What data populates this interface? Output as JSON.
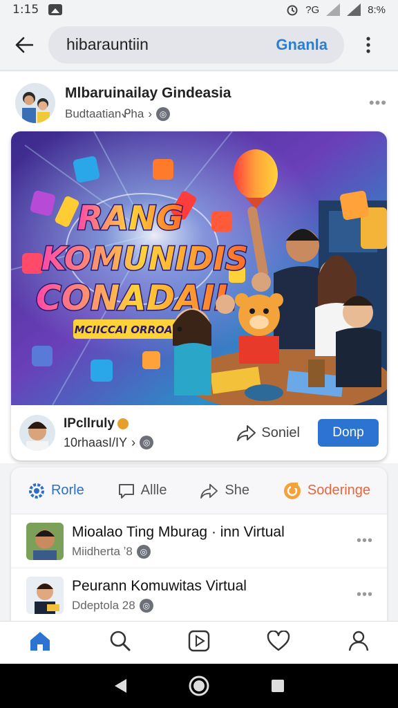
{
  "status_bar": {
    "time": "1:15",
    "battery": "8:%",
    "network": "?G"
  },
  "app_bar": {
    "query": "hibarauntiin",
    "action": "Gnanla"
  },
  "post": {
    "title": "Mlbaruinailay Gindeasia",
    "subtitle": "Budtaatianᕵha",
    "subtitle_arrow": "›",
    "banner": {
      "line1": "RANG",
      "line2": "KOMUNIDIS",
      "line3": "CONADAIL",
      "tagline": "MCIICCAI ORROAHU"
    },
    "footer": {
      "name": "IPcllruly",
      "meta": "10rhaasI/IY",
      "meta_arrow": "›",
      "share_label": "Soniel",
      "primary_label": "Donp"
    }
  },
  "actions": [
    {
      "label": "Rorle",
      "icon": "gear-icon"
    },
    {
      "label": "Allle",
      "icon": "comment-icon"
    },
    {
      "label": "She",
      "icon": "share-icon"
    },
    {
      "label": "Soderinge",
      "icon": "sticker-icon"
    }
  ],
  "comments": [
    {
      "title": "Mioalao Ting Mburag · inn Virtual",
      "meta": "Miidherta ʼ8"
    },
    {
      "title": "Peurann Komuwitas Virtual",
      "meta": "Ddeptola 28"
    }
  ],
  "bottom_nav": [
    "home-icon",
    "search-icon",
    "reels-icon",
    "heart-icon",
    "profile-icon"
  ],
  "colors": {
    "accent": "#2c73d2",
    "orange": "#e8653a",
    "bg": "#f2f3f5"
  }
}
